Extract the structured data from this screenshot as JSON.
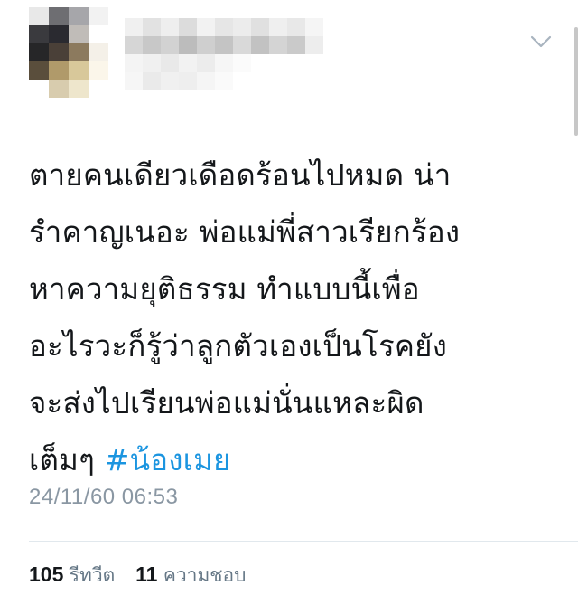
{
  "tweet": {
    "author": {
      "avatar_icon": "pixelated-avatar-icon",
      "name_blurred": true
    },
    "menu_icon": "chevron-down-icon",
    "text_lines": [
      "ตายคนเดียวเดือดร้อนไปหมด น่า",
      "รำคาญเนอะ พ่อแม่พี่สาวเรียกร้อง",
      "หาความยุติธรรม ทำแบบนี้เพื่อ",
      "อะไรวะก็รู้ว่าลูกตัวเองเป็นโรคยัง",
      "จะส่งไปเรียนพ่อแม่นั่นแหละผิด"
    ],
    "last_line_text": "เต็มๆ ",
    "hashtag": "#น้องเมย",
    "timestamp": "24/11/60 06:53",
    "stats": {
      "retweets_count": "105",
      "retweets_label": "รีทวีต",
      "likes_count": "11",
      "likes_label": "ความชอบ"
    },
    "colors": {
      "text": "#14171a",
      "hashtag": "#1b95e0",
      "meta": "#8a97a3",
      "divider": "#e1e8ed"
    }
  }
}
